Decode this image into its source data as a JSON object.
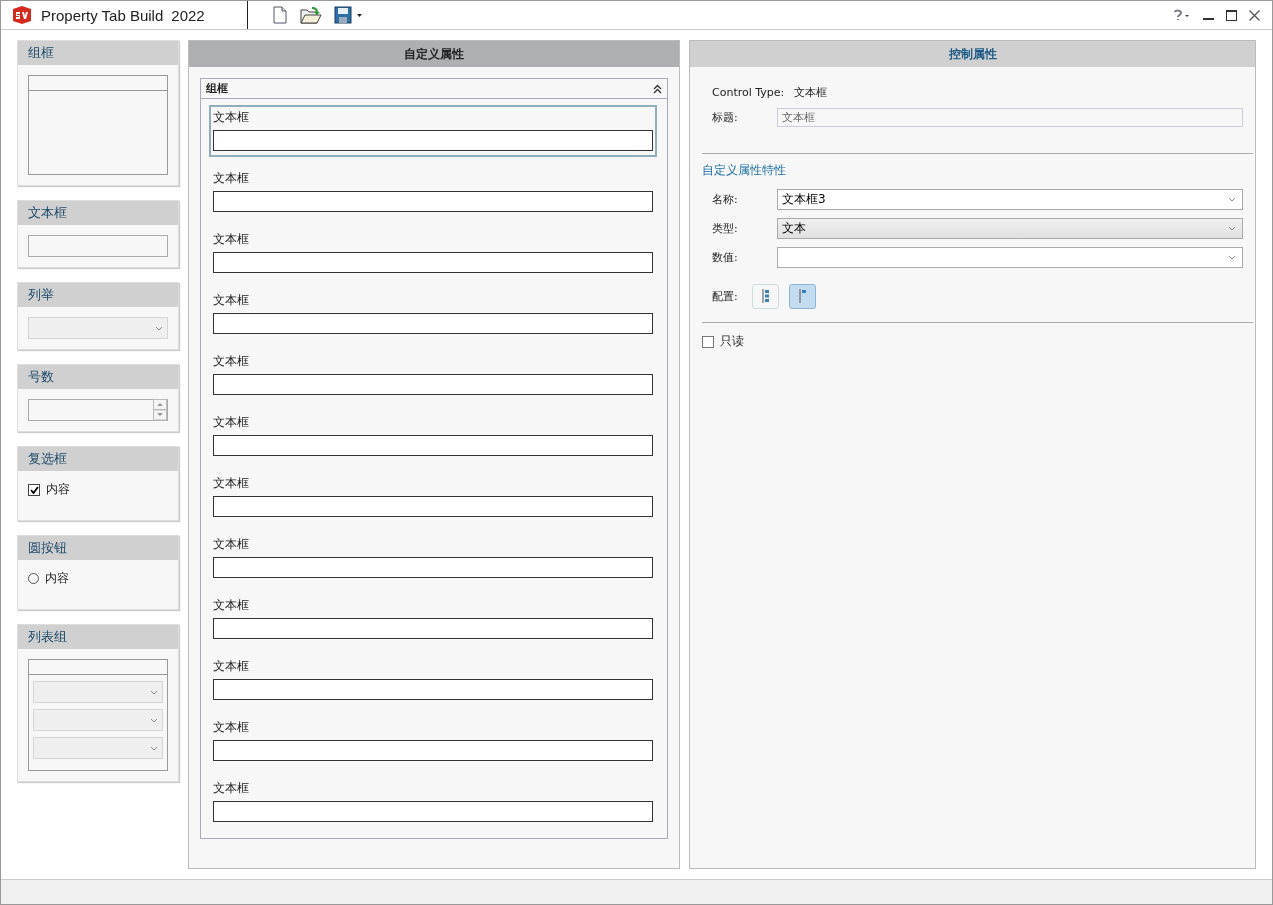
{
  "title_bar": {
    "app_name": "Property Tab Build",
    "version": "2022"
  },
  "palette": [
    {
      "kind": "groupbox",
      "title": "组框"
    },
    {
      "kind": "textbox",
      "title": "文本框"
    },
    {
      "kind": "combo",
      "title": "列举"
    },
    {
      "kind": "number",
      "title": "号数"
    },
    {
      "kind": "checkbox",
      "title": "复选框",
      "option": {
        "label": "内容",
        "checked": true
      }
    },
    {
      "kind": "radio",
      "title": "圆按钮",
      "option": {
        "label": "内容",
        "selected": false
      }
    },
    {
      "kind": "listgroup",
      "title": "列表组"
    }
  ],
  "custom_properties": {
    "title": "自定义属性",
    "group": {
      "title": "组框",
      "expanded": true,
      "fields": [
        {
          "label": "文本框",
          "selected": true
        },
        {
          "label": "文本框",
          "selected": false
        },
        {
          "label": "文本框",
          "selected": false
        },
        {
          "label": "文本框",
          "selected": false
        },
        {
          "label": "文本框",
          "selected": false
        },
        {
          "label": "文本框",
          "selected": false
        },
        {
          "label": "文本框",
          "selected": false
        },
        {
          "label": "文本框",
          "selected": false
        },
        {
          "label": "文本框",
          "selected": false
        },
        {
          "label": "文本框",
          "selected": false
        },
        {
          "label": "文本框",
          "selected": false
        },
        {
          "label": "文本框",
          "selected": false
        }
      ]
    }
  },
  "control_properties": {
    "title": "控制属性",
    "control_type_label": "Control Type:",
    "control_type_value": "文本框",
    "caption": {
      "label": "标题:",
      "value": "文本框"
    },
    "section_title": "自定义属性特性",
    "rows": [
      {
        "label": "名称:",
        "value": "文本框3",
        "shaded": false
      },
      {
        "label": "类型:",
        "value": "文本",
        "shaded": true
      },
      {
        "label": "数值:",
        "shaded": false
      }
    ],
    "config_label": "配置:",
    "config_buttons": [
      {
        "kind": "stacked",
        "selected": false
      },
      {
        "kind": "flag",
        "selected": true
      }
    ],
    "read_only": {
      "label": "只读",
      "checked": false
    }
  }
}
